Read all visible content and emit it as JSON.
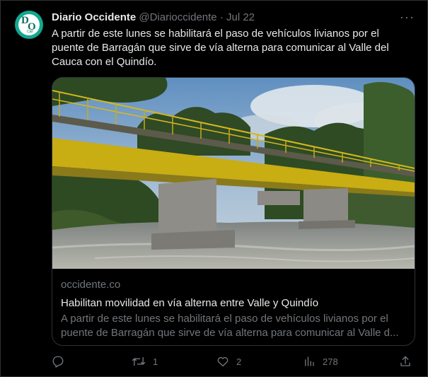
{
  "author": {
    "name": "Diario Occidente",
    "handle": "@Diarioccidente",
    "separator": "·",
    "date": "Jul 22",
    "avatar_letters": {
      "top": "D",
      "bottom": "O",
      "sub": "Cali"
    }
  },
  "more_label": "···",
  "tweet_text": "A partir de este lunes se habilitará el paso de vehículos livianos por el puente de Barragán que sirve de vía alterna para comunicar al Valle del Cauca con el Quindío.",
  "card": {
    "domain": "occidente.co",
    "title": "Habilitan movilidad en vía alterna entre Valle y Quindío",
    "description": "A partir de este lunes se habilitará el paso de vehículos livianos por el puente de Barragán que sirve de vía alterna para comunicar al Valle d..."
  },
  "actions": {
    "reply_count": "",
    "retweet_count": "1",
    "like_count": "2",
    "views_count": "278"
  },
  "icons": [
    "reply-icon",
    "retweet-icon",
    "like-icon",
    "views-icon",
    "share-icon"
  ],
  "colors": {
    "background": "#000000",
    "text": "#e7e9ea",
    "secondary": "#71767b",
    "border": "#2f3336",
    "avatar": "#11a991"
  }
}
